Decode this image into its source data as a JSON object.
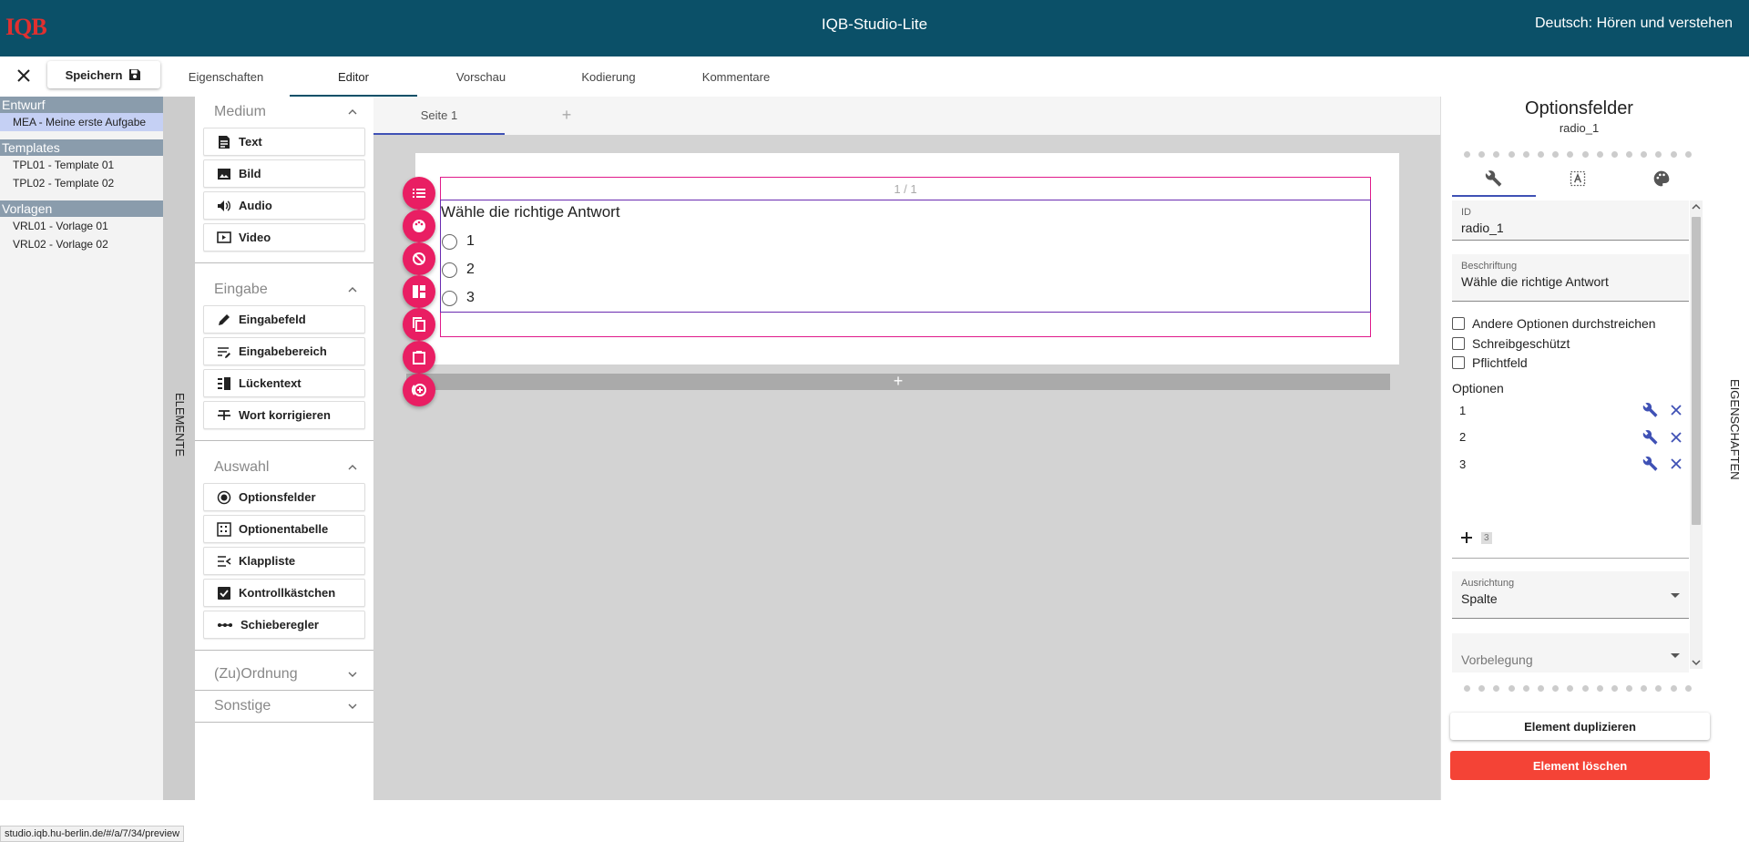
{
  "header": {
    "logo_text": "IQB",
    "app_title": "IQB-Studio-Lite",
    "unit_title": "Deutsch: Hören und verstehen"
  },
  "toolbar": {
    "save_label": "Speichern"
  },
  "tabs": [
    "Eigenschaften",
    "Editor",
    "Vorschau",
    "Kodierung",
    "Kommentare"
  ],
  "active_tab": "Editor",
  "sidebar": {
    "groups": [
      {
        "title": "Entwurf",
        "items": [
          "MEA - Meine erste Aufgabe"
        ]
      },
      {
        "title": "Templates",
        "items": [
          "TPL01 - Template 01",
          "TPL02 - Template 02"
        ]
      },
      {
        "title": "Vorlagen",
        "items": [
          "VRL01 - Vorlage 01",
          "VRL02 - Vorlage 02"
        ]
      }
    ]
  },
  "elements_label": "ELEMENTE",
  "properties_label": "EIGENSCHAFTEN",
  "element_panel": {
    "sections": [
      {
        "title": "Medium",
        "expanded": true,
        "items": [
          "Text",
          "Bild",
          "Audio",
          "Video"
        ]
      },
      {
        "title": "Eingabe",
        "expanded": true,
        "items": [
          "Eingabefeld",
          "Eingabebereich",
          "Lückentext",
          "Wort korrigieren"
        ]
      },
      {
        "title": "Auswahl",
        "expanded": true,
        "items": [
          "Optionsfelder",
          "Optionentabelle",
          "Klappliste",
          "Kontrollkästchen",
          "Schieberegler"
        ]
      },
      {
        "title": "(Zu)Ordnung",
        "expanded": false,
        "items": []
      },
      {
        "title": "Sonstige",
        "expanded": false,
        "items": []
      }
    ]
  },
  "editor": {
    "page_tab": "Seite 1",
    "add_page": "+",
    "section_label": "1 / 1",
    "element": {
      "title": "Wähle die richtige Antwort",
      "options": [
        "1",
        "2",
        "3"
      ]
    },
    "add_section": "+"
  },
  "properties": {
    "title": "Optionsfelder",
    "subtitle": "radio_1",
    "id_label": "ID",
    "id_value": "radio_1",
    "caption_label": "Beschriftung",
    "caption_value": "Wähle die richtige Antwort",
    "checkboxes": [
      "Andere Optionen durchstreichen",
      "Schreibgeschützt",
      "Pflichtfeld"
    ],
    "options_label": "Optionen",
    "options": [
      "1",
      "2",
      "3"
    ],
    "new_option_value": "3",
    "alignment_label": "Ausrichtung",
    "alignment_value": "Spalte",
    "preset_label": "Vorbelegung",
    "duplicate_label": "Element duplizieren",
    "delete_label": "Element löschen"
  },
  "status_url": "studio.iqb.hu-berlin.de/#/a/7/34/preview",
  "colors": {
    "header": "#0b5068",
    "accent": "#e91e63",
    "delete": "#f44336",
    "tab_indicator": "#3f51b5",
    "selection": "#c5d0f4"
  }
}
